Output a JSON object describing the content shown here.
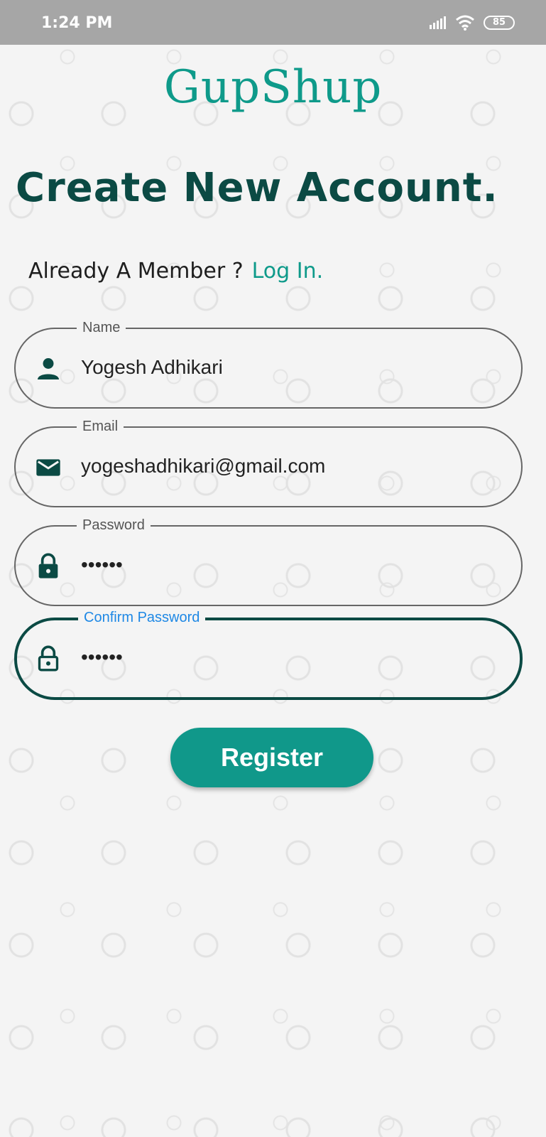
{
  "status_bar": {
    "time": "1:24 PM",
    "battery": "85"
  },
  "app": {
    "logo": "GupShup"
  },
  "header": {
    "title": "Create New Account."
  },
  "member_prompt": {
    "text": "Already A Member ?",
    "link": "Log In."
  },
  "fields": {
    "name": {
      "label": "Name",
      "value": "Yogesh Adhikari",
      "icon": "person-icon"
    },
    "email": {
      "label": "Email",
      "value": "yogeshadhikari@gmail.com",
      "icon": "mail-icon"
    },
    "password": {
      "label": "Password",
      "value": "••••••",
      "icon": "lock-icon"
    },
    "confirm_password": {
      "label": "Confirm Password",
      "value": "••••••",
      "icon": "lock-open-icon",
      "focused": true
    }
  },
  "actions": {
    "register_label": "Register"
  },
  "colors": {
    "accent": "#0e9a8a",
    "dark_teal": "#0b4a44",
    "focus_label": "#1e88e5",
    "status_bar": "#a6a6a6"
  }
}
